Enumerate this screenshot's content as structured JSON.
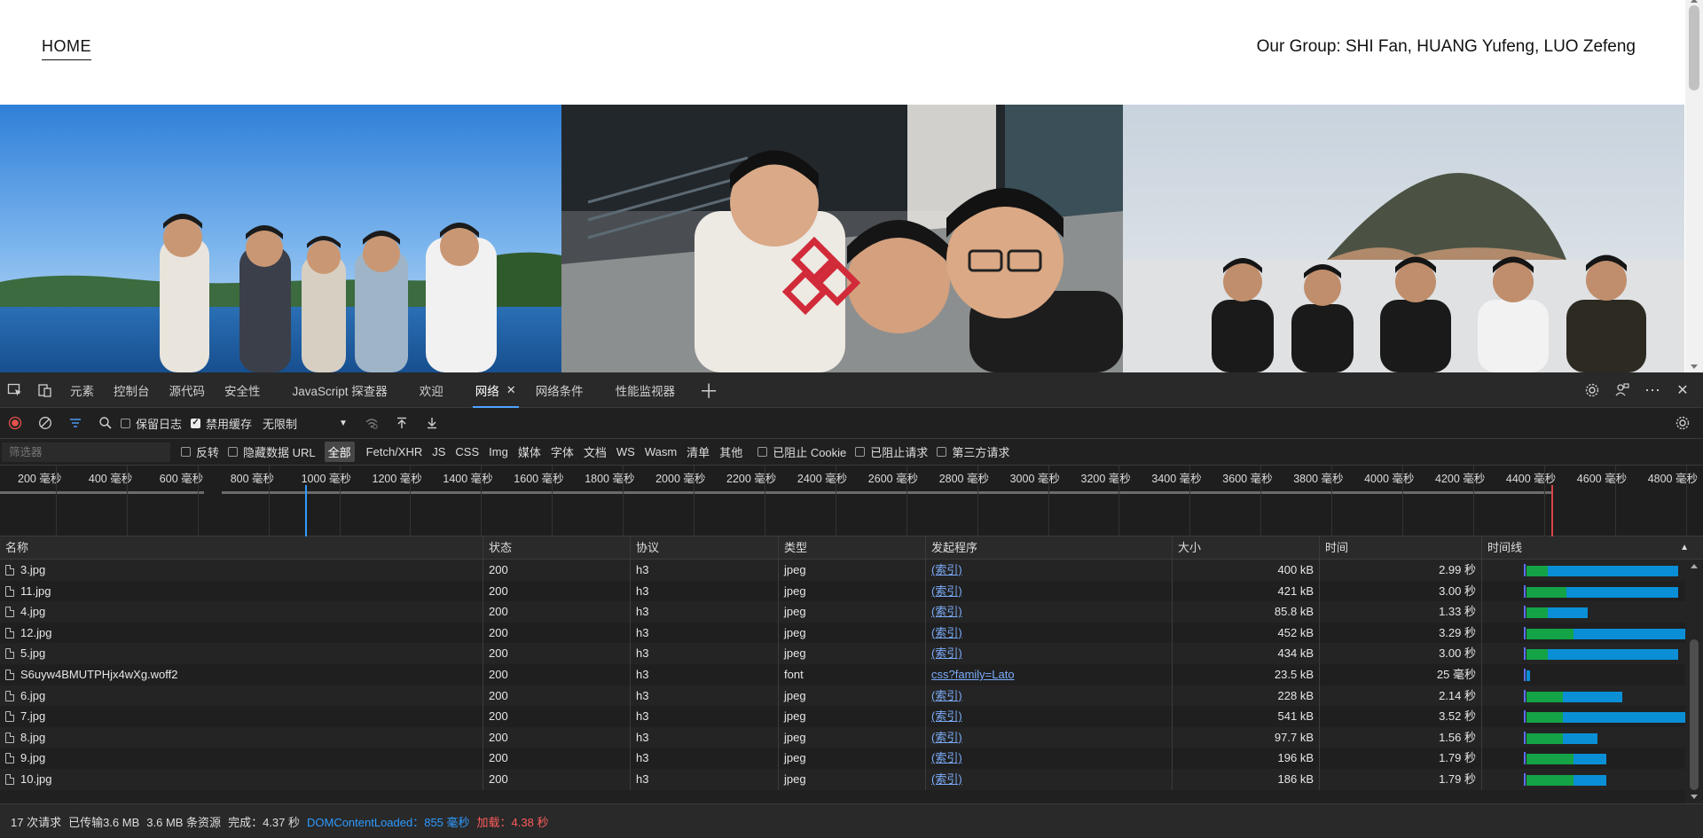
{
  "page": {
    "home_label": "HOME",
    "group_title": "Our Group: SHI Fan, HUANG Yufeng, LUO Zefeng"
  },
  "devtools": {
    "tabs": [
      {
        "label": "元素"
      },
      {
        "label": "控制台"
      },
      {
        "label": "源代码"
      },
      {
        "label": "安全性"
      },
      {
        "label": "JavaScript 探查器"
      },
      {
        "label": "欢迎"
      },
      {
        "label": "网络",
        "active": true
      },
      {
        "label": "网络条件"
      },
      {
        "label": "性能监视器"
      }
    ],
    "toolbar": {
      "preserve_log": "保留日志",
      "disable_cache": "禁用缓存",
      "throttle": "无限制"
    },
    "filter": {
      "placeholder": "筛选器",
      "invert": "反转",
      "hide_data_urls": "隐藏数据 URL",
      "types": [
        "全部",
        "Fetch/XHR",
        "JS",
        "CSS",
        "Img",
        "媒体",
        "字体",
        "文档",
        "WS",
        "Wasm",
        "清单",
        "其他"
      ],
      "blocked_cookies": "已阻止 Cookie",
      "blocked_requests": "已阻止请求",
      "third_party": "第三方请求"
    },
    "overview_ticks": [
      "200 毫秒",
      "400 毫秒",
      "600 毫秒",
      "800 毫秒",
      "1000 毫秒",
      "1200 毫秒",
      "1400 毫秒",
      "1600 毫秒",
      "1800 毫秒",
      "2000 毫秒",
      "2200 毫秒",
      "2400 毫秒",
      "2600 毫秒",
      "2800 毫秒",
      "3000 毫秒",
      "3200 毫秒",
      "3400 毫秒",
      "3600 毫秒",
      "3800 毫秒",
      "4000 毫秒",
      "4200 毫秒",
      "4400 毫秒",
      "4600 毫秒",
      "4800 毫秒"
    ],
    "columns": [
      "名称",
      "状态",
      "协议",
      "类型",
      "发起程序",
      "大小",
      "时间",
      "时间线"
    ],
    "rows": [
      {
        "name": "3.jpg",
        "status": "200",
        "protocol": "h3",
        "type": "jpeg",
        "initiator": "(索引)",
        "size": "400 kB",
        "time": "2.99 秒",
        "wait": 0.12,
        "recv": 0.72
      },
      {
        "name": "11.jpg",
        "status": "200",
        "protocol": "h3",
        "type": "jpeg",
        "initiator": "(索引)",
        "size": "421 kB",
        "time": "3.00 秒",
        "wait": 0.22,
        "recv": 0.62
      },
      {
        "name": "4.jpg",
        "status": "200",
        "protocol": "h3",
        "type": "jpeg",
        "initiator": "(索引)",
        "size": "85.8 kB",
        "time": "1.33 秒",
        "wait": 0.12,
        "recv": 0.22
      },
      {
        "name": "12.jpg",
        "status": "200",
        "protocol": "h3",
        "type": "jpeg",
        "initiator": "(索引)",
        "size": "452 kB",
        "time": "3.29 秒",
        "wait": 0.26,
        "recv": 0.64
      },
      {
        "name": "5.jpg",
        "status": "200",
        "protocol": "h3",
        "type": "jpeg",
        "initiator": "(索引)",
        "size": "434 kB",
        "time": "3.00 秒",
        "wait": 0.12,
        "recv": 0.72
      },
      {
        "name": "S6uyw4BMUTPHjx4wXg.woff2",
        "status": "200",
        "protocol": "h3",
        "type": "font",
        "initiator": "css?family=Lato",
        "size": "23.5 kB",
        "time": "25 毫秒",
        "wait": 0.0,
        "recv": 0.02
      },
      {
        "name": "6.jpg",
        "status": "200",
        "protocol": "h3",
        "type": "jpeg",
        "initiator": "(索引)",
        "size": "228 kB",
        "time": "2.14 秒",
        "wait": 0.2,
        "recv": 0.33
      },
      {
        "name": "7.jpg",
        "status": "200",
        "protocol": "h3",
        "type": "jpeg",
        "initiator": "(索引)",
        "size": "541 kB",
        "time": "3.52 秒",
        "wait": 0.2,
        "recv": 0.83
      },
      {
        "name": "8.jpg",
        "status": "200",
        "protocol": "h3",
        "type": "jpeg",
        "initiator": "(索引)",
        "size": "97.7 kB",
        "time": "1.56 秒",
        "wait": 0.2,
        "recv": 0.19
      },
      {
        "name": "9.jpg",
        "status": "200",
        "protocol": "h3",
        "type": "jpeg",
        "initiator": "(索引)",
        "size": "196 kB",
        "time": "1.79 秒",
        "wait": 0.26,
        "recv": 0.18
      },
      {
        "name": "10.jpg",
        "status": "200",
        "protocol": "h3",
        "type": "jpeg",
        "initiator": "(索引)",
        "size": "186 kB",
        "time": "1.79 秒",
        "wait": 0.26,
        "recv": 0.18
      }
    ],
    "status": {
      "requests": "17 次请求",
      "transferred": "已传输3.6 MB",
      "resources": "3.6 MB 条资源",
      "finish": "完成：4.37 秒",
      "dom_content_loaded": "DOMContentLoaded：855 毫秒",
      "load": "加载：4.38 秒"
    },
    "colors": {
      "accent": "#4fa3ff",
      "dcl": "#2e9bff",
      "load": "#ff5c5c",
      "waterfall_wait": "#14a346",
      "waterfall_recv": "#0a8fd6"
    }
  }
}
